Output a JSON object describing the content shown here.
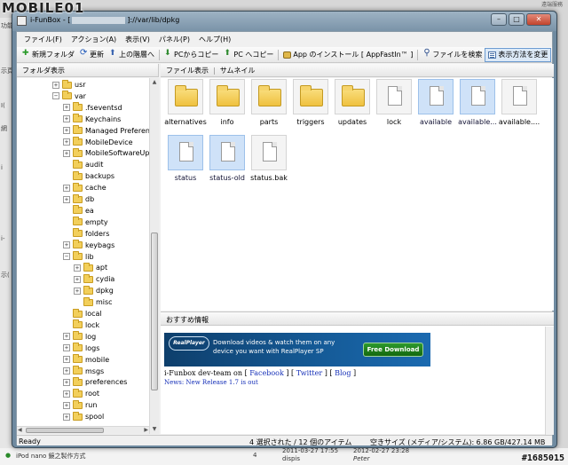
{
  "watermark_top": "MOBILE01",
  "watermark_bottom": "#1685015",
  "background": {
    "top_right_text": "遠端服務",
    "left_snippets": [
      "功能",
      "示頁",
      "I(",
      "i-",
      "示(",
      "網",
      "i"
    ],
    "bottom_row": {
      "item": "iPod nano 鏡之製作方式",
      "count": "4",
      "date1": "2011-03-27 17:55",
      "user1": "dispis",
      "date2": "2012-02-27 23:28",
      "user2": "Peter"
    }
  },
  "window": {
    "title_prefix": "i-FunBox - [",
    "title_path": "]://var/lib/dpkg",
    "minimize": "–",
    "maximize": "□",
    "close": "✕"
  },
  "menu": [
    "ファイル(F)",
    "アクション(A)",
    "表示(V)",
    "パネル(P)",
    "ヘルプ(H)"
  ],
  "toolbar": {
    "new_folder": "新規フォルダ",
    "refresh": "更新",
    "up": "上の階層へ",
    "copy_from_pc": "PCからコピー",
    "copy_to_pc": "PC へコピー",
    "install_app": "App のインストール [ AppFastIn™ ]",
    "search": "ファイルを検索",
    "view_mode": "表示方法を変更"
  },
  "left_panel_title": "フォルダ表示",
  "right_panel_tabs": [
    "ファイル表示",
    "サムネイル"
  ],
  "tree": [
    {
      "label": "usr",
      "exp": "+",
      "level": 0
    },
    {
      "label": "var",
      "exp": "−",
      "level": 0
    },
    {
      "label": ".fseventsd",
      "exp": "+",
      "level": 1
    },
    {
      "label": "Keychains",
      "exp": "+",
      "level": 1
    },
    {
      "label": "Managed Preferences",
      "exp": "+",
      "level": 1
    },
    {
      "label": "MobileDevice",
      "exp": "+",
      "level": 1
    },
    {
      "label": "MobileSoftwareUpdate",
      "exp": "+",
      "level": 1
    },
    {
      "label": "audit",
      "exp": "",
      "level": 1
    },
    {
      "label": "backups",
      "exp": "",
      "level": 1
    },
    {
      "label": "cache",
      "exp": "+",
      "level": 1
    },
    {
      "label": "db",
      "exp": "+",
      "level": 1
    },
    {
      "label": "ea",
      "exp": "",
      "level": 1
    },
    {
      "label": "empty",
      "exp": "",
      "level": 1
    },
    {
      "label": "folders",
      "exp": "",
      "level": 1
    },
    {
      "label": "keybags",
      "exp": "+",
      "level": 1
    },
    {
      "label": "lib",
      "exp": "−",
      "level": 1
    },
    {
      "label": "apt",
      "exp": "+",
      "level": 2
    },
    {
      "label": "cydia",
      "exp": "+",
      "level": 2
    },
    {
      "label": "dpkg",
      "exp": "+",
      "level": 2
    },
    {
      "label": "misc",
      "exp": "",
      "level": 2
    },
    {
      "label": "local",
      "exp": "",
      "level": 1
    },
    {
      "label": "lock",
      "exp": "",
      "level": 1
    },
    {
      "label": "log",
      "exp": "+",
      "level": 1
    },
    {
      "label": "logs",
      "exp": "+",
      "level": 1
    },
    {
      "label": "mobile",
      "exp": "+",
      "level": 1
    },
    {
      "label": "msgs",
      "exp": "+",
      "level": 1
    },
    {
      "label": "preferences",
      "exp": "+",
      "level": 1
    },
    {
      "label": "root",
      "exp": "+",
      "level": 1
    },
    {
      "label": "run",
      "exp": "+",
      "level": 1
    },
    {
      "label": "spool",
      "exp": "+",
      "level": 1
    }
  ],
  "files": [
    {
      "name": "alternatives",
      "kind": "folder",
      "selected": false
    },
    {
      "name": "info",
      "kind": "folder",
      "selected": false
    },
    {
      "name": "parts",
      "kind": "folder",
      "selected": false
    },
    {
      "name": "triggers",
      "kind": "folder",
      "selected": false
    },
    {
      "name": "updates",
      "kind": "folder",
      "selected": false
    },
    {
      "name": "lock",
      "kind": "file",
      "selected": false
    },
    {
      "name": "available",
      "kind": "file",
      "selected": true
    },
    {
      "name": "available...",
      "kind": "file",
      "selected": true
    },
    {
      "name": "available....",
      "kind": "file",
      "selected": false
    },
    {
      "name": "status",
      "kind": "file",
      "selected": true
    },
    {
      "name": "status-old",
      "kind": "file",
      "selected": true
    },
    {
      "name": "status.bak",
      "kind": "file",
      "selected": false
    }
  ],
  "recommendations": {
    "title": "おすすめ情報",
    "ad": {
      "logo": "RealPlayer",
      "text": "Download videos & watch them on any device you want with RealPlayer SP",
      "button": "Free Download"
    },
    "dev_team_prefix": "i-Funbox dev-team on",
    "links": [
      "Facebook",
      "Twitter",
      "Blog"
    ],
    "news": "News: New Release 1.7 is out"
  },
  "status": {
    "ready": "Ready",
    "selection": "4 選択された / 12 個のアイテム",
    "space": "空きサイズ (メディア/システム): 6.86 GB/427.14 MB"
  }
}
